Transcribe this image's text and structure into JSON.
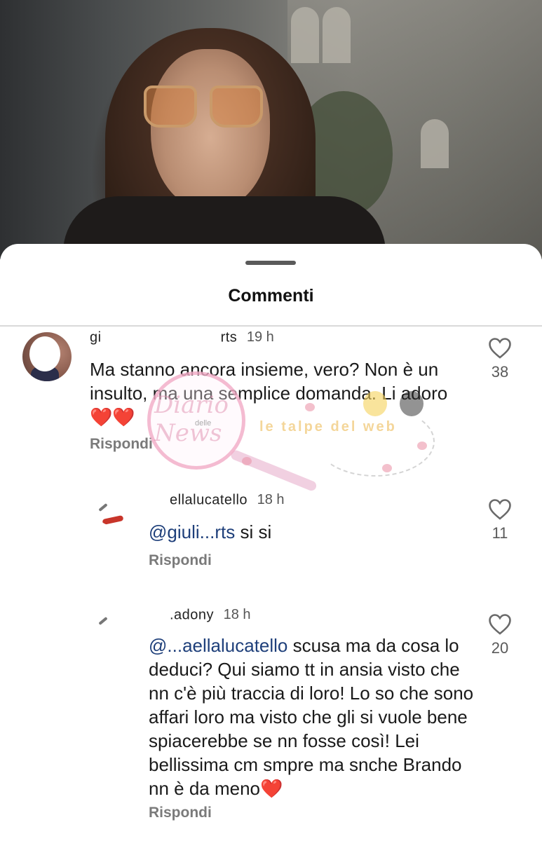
{
  "sheet": {
    "title": "Commenti"
  },
  "comments": [
    {
      "username": "gi",
      "username_tail": "rts",
      "time": "19 h",
      "text": "Ma stanno ancora insieme, vero? Non è un insulto, ma una semplice domanda. Li adoro",
      "text_emoji": "❤️❤️",
      "reply_label": "Rispondi",
      "likes": "38"
    },
    {
      "username": "ellalucatello",
      "time": "18 h",
      "mention": "@giuli...rts",
      "text": "si si",
      "reply_label": "Rispondi",
      "likes": "11"
    },
    {
      "username": ".adony",
      "time": "18 h",
      "mention": "@...aellalucatello",
      "text": "scusa ma da cosa lo deduci? Qui siamo tt in ansia visto che nn c'è più traccia di loro! Lo so che sono affari loro ma visto che gli si vuole bene spiacerebbe se nn fosse così! Lei bellissima cm smpre ma snche Brando nn è da meno",
      "text_emoji": "❤️",
      "reply_label": "Rispondi",
      "likes": "20"
    }
  ],
  "watermark": {
    "script": "Diario delle News",
    "delle": "delle",
    "banner": "le talpe del web"
  },
  "colors": {
    "mention": "#1e3f7a",
    "reply": "#7a7a7a",
    "heart_emoji": "#e0212b"
  },
  "icons": {
    "like": "heart-outline-icon",
    "drag_handle": "drag-handle-icon"
  }
}
